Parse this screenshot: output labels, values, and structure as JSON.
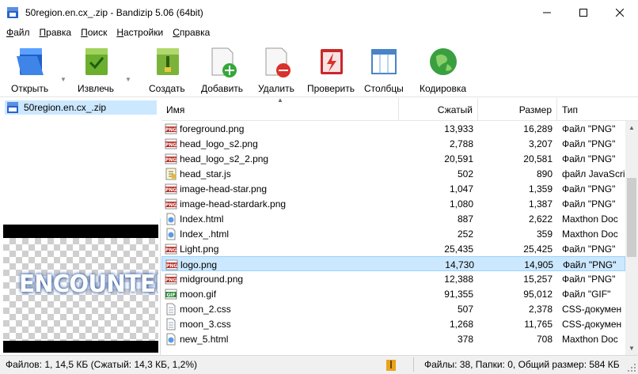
{
  "window": {
    "title": "50region.en.cx_.zip - Bandizip 5.06 (64bit)"
  },
  "menu": [
    {
      "u": "Ф",
      "rest": "айл"
    },
    {
      "u": "П",
      "rest": "равка"
    },
    {
      "u": "П",
      "rest": "оиск"
    },
    {
      "u": "Н",
      "rest": "астройки"
    },
    {
      "u": "С",
      "rest": "правка"
    }
  ],
  "toolbar": {
    "open": "Открыть",
    "extract": "Извлечь",
    "create": "Создать",
    "add": "Добавить",
    "delete": "Удалить",
    "test": "Проверить",
    "columns": "Столбцы",
    "encoding": "Кодировка"
  },
  "tree": {
    "archive": "50region.en.cx_.zip"
  },
  "preview": {
    "logo_text": "ENCOUNTER"
  },
  "columns": {
    "name": "Имя",
    "compressed": "Сжатый",
    "size": "Размер",
    "type": "Тип"
  },
  "files": [
    {
      "name": "foreground.png",
      "compressed": "13,933",
      "size": "16,289",
      "type": "Файл \"PNG\"",
      "icon": "png-file-icon"
    },
    {
      "name": "head_logo_s2.png",
      "compressed": "2,788",
      "size": "3,207",
      "type": "Файл \"PNG\"",
      "icon": "png-file-icon"
    },
    {
      "name": "head_logo_s2_2.png",
      "compressed": "20,591",
      "size": "20,581",
      "type": "Файл \"PNG\"",
      "icon": "png-file-icon"
    },
    {
      "name": "head_star.js",
      "compressed": "502",
      "size": "890",
      "type": "файл JavaScri",
      "icon": "js-file-icon"
    },
    {
      "name": "image-head-star.png",
      "compressed": "1,047",
      "size": "1,359",
      "type": "Файл \"PNG\"",
      "icon": "png-file-icon"
    },
    {
      "name": "image-head-stardark.png",
      "compressed": "1,080",
      "size": "1,387",
      "type": "Файл \"PNG\"",
      "icon": "png-file-icon"
    },
    {
      "name": "Index.html",
      "compressed": "887",
      "size": "2,622",
      "type": "Maxthon Doc",
      "icon": "html-file-icon"
    },
    {
      "name": "Index_.html",
      "compressed": "252",
      "size": "359",
      "type": "Maxthon Doc",
      "icon": "html-file-icon"
    },
    {
      "name": "Light.png",
      "compressed": "25,435",
      "size": "25,425",
      "type": "Файл \"PNG\"",
      "icon": "png-file-icon"
    },
    {
      "name": "logo.png",
      "compressed": "14,730",
      "size": "14,905",
      "type": "Файл \"PNG\"",
      "icon": "png-file-icon",
      "selected": true
    },
    {
      "name": "midground.png",
      "compressed": "12,388",
      "size": "15,257",
      "type": "Файл \"PNG\"",
      "icon": "png-file-icon"
    },
    {
      "name": "moon.gif",
      "compressed": "91,355",
      "size": "95,012",
      "type": "Файл \"GIF\"",
      "icon": "gif-file-icon"
    },
    {
      "name": "moon_2.css",
      "compressed": "507",
      "size": "2,378",
      "type": "CSS-докумен",
      "icon": "css-file-icon"
    },
    {
      "name": "moon_3.css",
      "compressed": "1,268",
      "size": "11,765",
      "type": "CSS-докумен",
      "icon": "css-file-icon"
    },
    {
      "name": "new_5.html",
      "compressed": "378",
      "size": "708",
      "type": "Maxthon Doc",
      "icon": "html-file-icon"
    }
  ],
  "status": {
    "left": "Файлов: 1, 14,5 КБ (Сжатый: 14,3 КБ, 1,2%)",
    "right": "Файлы: 38, Папки: 0, Общий размер: 584 КБ"
  }
}
